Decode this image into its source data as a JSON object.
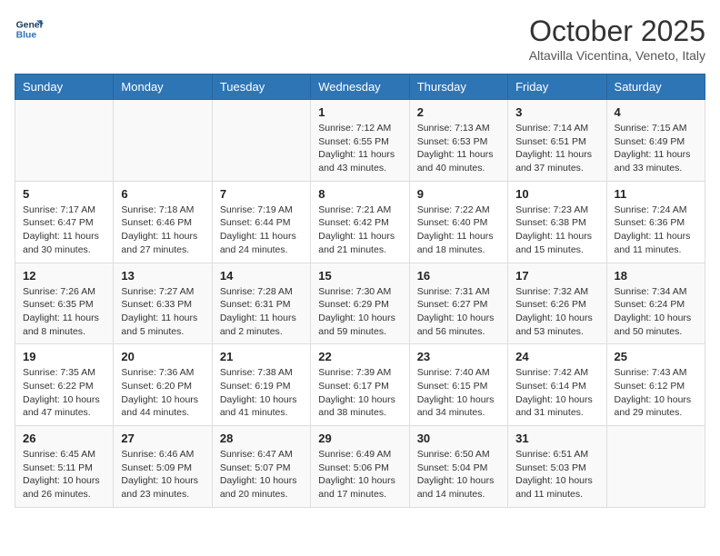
{
  "logo": {
    "line1": "General",
    "line2": "Blue"
  },
  "header": {
    "title": "October 2025",
    "subtitle": "Altavilla Vicentina, Veneto, Italy"
  },
  "weekdays": [
    "Sunday",
    "Monday",
    "Tuesday",
    "Wednesday",
    "Thursday",
    "Friday",
    "Saturday"
  ],
  "weeks": [
    [
      {
        "day": "",
        "info": ""
      },
      {
        "day": "",
        "info": ""
      },
      {
        "day": "",
        "info": ""
      },
      {
        "day": "1",
        "info": "Sunrise: 7:12 AM\nSunset: 6:55 PM\nDaylight: 11 hours and 43 minutes."
      },
      {
        "day": "2",
        "info": "Sunrise: 7:13 AM\nSunset: 6:53 PM\nDaylight: 11 hours and 40 minutes."
      },
      {
        "day": "3",
        "info": "Sunrise: 7:14 AM\nSunset: 6:51 PM\nDaylight: 11 hours and 37 minutes."
      },
      {
        "day": "4",
        "info": "Sunrise: 7:15 AM\nSunset: 6:49 PM\nDaylight: 11 hours and 33 minutes."
      }
    ],
    [
      {
        "day": "5",
        "info": "Sunrise: 7:17 AM\nSunset: 6:47 PM\nDaylight: 11 hours and 30 minutes."
      },
      {
        "day": "6",
        "info": "Sunrise: 7:18 AM\nSunset: 6:46 PM\nDaylight: 11 hours and 27 minutes."
      },
      {
        "day": "7",
        "info": "Sunrise: 7:19 AM\nSunset: 6:44 PM\nDaylight: 11 hours and 24 minutes."
      },
      {
        "day": "8",
        "info": "Sunrise: 7:21 AM\nSunset: 6:42 PM\nDaylight: 11 hours and 21 minutes."
      },
      {
        "day": "9",
        "info": "Sunrise: 7:22 AM\nSunset: 6:40 PM\nDaylight: 11 hours and 18 minutes."
      },
      {
        "day": "10",
        "info": "Sunrise: 7:23 AM\nSunset: 6:38 PM\nDaylight: 11 hours and 15 minutes."
      },
      {
        "day": "11",
        "info": "Sunrise: 7:24 AM\nSunset: 6:36 PM\nDaylight: 11 hours and 11 minutes."
      }
    ],
    [
      {
        "day": "12",
        "info": "Sunrise: 7:26 AM\nSunset: 6:35 PM\nDaylight: 11 hours and 8 minutes."
      },
      {
        "day": "13",
        "info": "Sunrise: 7:27 AM\nSunset: 6:33 PM\nDaylight: 11 hours and 5 minutes."
      },
      {
        "day": "14",
        "info": "Sunrise: 7:28 AM\nSunset: 6:31 PM\nDaylight: 11 hours and 2 minutes."
      },
      {
        "day": "15",
        "info": "Sunrise: 7:30 AM\nSunset: 6:29 PM\nDaylight: 10 hours and 59 minutes."
      },
      {
        "day": "16",
        "info": "Sunrise: 7:31 AM\nSunset: 6:27 PM\nDaylight: 10 hours and 56 minutes."
      },
      {
        "day": "17",
        "info": "Sunrise: 7:32 AM\nSunset: 6:26 PM\nDaylight: 10 hours and 53 minutes."
      },
      {
        "day": "18",
        "info": "Sunrise: 7:34 AM\nSunset: 6:24 PM\nDaylight: 10 hours and 50 minutes."
      }
    ],
    [
      {
        "day": "19",
        "info": "Sunrise: 7:35 AM\nSunset: 6:22 PM\nDaylight: 10 hours and 47 minutes."
      },
      {
        "day": "20",
        "info": "Sunrise: 7:36 AM\nSunset: 6:20 PM\nDaylight: 10 hours and 44 minutes."
      },
      {
        "day": "21",
        "info": "Sunrise: 7:38 AM\nSunset: 6:19 PM\nDaylight: 10 hours and 41 minutes."
      },
      {
        "day": "22",
        "info": "Sunrise: 7:39 AM\nSunset: 6:17 PM\nDaylight: 10 hours and 38 minutes."
      },
      {
        "day": "23",
        "info": "Sunrise: 7:40 AM\nSunset: 6:15 PM\nDaylight: 10 hours and 34 minutes."
      },
      {
        "day": "24",
        "info": "Sunrise: 7:42 AM\nSunset: 6:14 PM\nDaylight: 10 hours and 31 minutes."
      },
      {
        "day": "25",
        "info": "Sunrise: 7:43 AM\nSunset: 6:12 PM\nDaylight: 10 hours and 29 minutes."
      }
    ],
    [
      {
        "day": "26",
        "info": "Sunrise: 6:45 AM\nSunset: 5:11 PM\nDaylight: 10 hours and 26 minutes."
      },
      {
        "day": "27",
        "info": "Sunrise: 6:46 AM\nSunset: 5:09 PM\nDaylight: 10 hours and 23 minutes."
      },
      {
        "day": "28",
        "info": "Sunrise: 6:47 AM\nSunset: 5:07 PM\nDaylight: 10 hours and 20 minutes."
      },
      {
        "day": "29",
        "info": "Sunrise: 6:49 AM\nSunset: 5:06 PM\nDaylight: 10 hours and 17 minutes."
      },
      {
        "day": "30",
        "info": "Sunrise: 6:50 AM\nSunset: 5:04 PM\nDaylight: 10 hours and 14 minutes."
      },
      {
        "day": "31",
        "info": "Sunrise: 6:51 AM\nSunset: 5:03 PM\nDaylight: 10 hours and 11 minutes."
      },
      {
        "day": "",
        "info": ""
      }
    ]
  ]
}
